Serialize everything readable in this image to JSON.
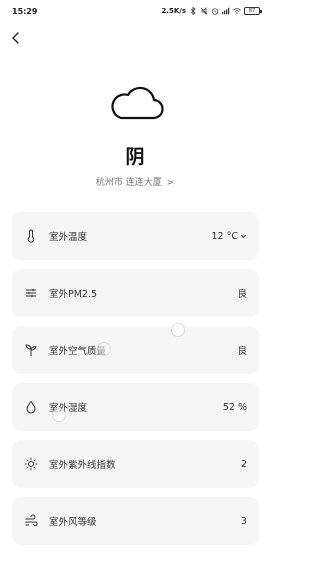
{
  "status_bar": {
    "time": "15:29",
    "network_speed": "2.5K/s",
    "battery": "87"
  },
  "weather": {
    "condition": "阴",
    "location_city": "杭州市",
    "location_place": "连连大厦",
    "location_chevron": ">"
  },
  "metrics": [
    {
      "label": "室外温度",
      "value": "12 °C",
      "icon": "thermometer-icon"
    },
    {
      "label": "室外PM2.5",
      "value": "良",
      "icon": "sliders-icon"
    },
    {
      "label": "室外空气质量",
      "value": "良",
      "icon": "sprout-icon"
    },
    {
      "label": "室外湿度",
      "value": "52 %",
      "icon": "droplet-icon"
    },
    {
      "label": "室外紫外线指数",
      "value": "2",
      "icon": "sun-icon"
    },
    {
      "label": "室外风等级",
      "value": "3",
      "icon": "wind-icon"
    }
  ],
  "colors": {
    "card_background": "#f6f6f6",
    "text": "#333333",
    "subtext": "#777777"
  }
}
